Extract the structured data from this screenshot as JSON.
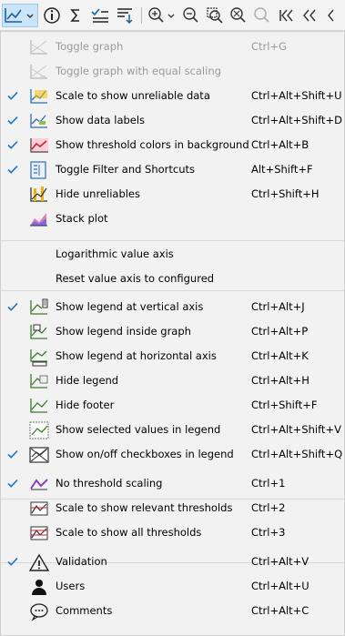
{
  "toolbar": {
    "buttons": [
      {
        "icon": "graph-dropdown-icon",
        "active": true
      },
      {
        "icon": "info-icon"
      },
      {
        "icon": "sigma-icon"
      },
      {
        "icon": "filter-check-icon"
      },
      {
        "icon": "sort-icon"
      },
      {
        "icon": "zoom-in-dropdown-icon"
      },
      {
        "icon": "zoom-out-icon"
      },
      {
        "icon": "zoom-area-icon"
      },
      {
        "icon": "zoom-reset-icon"
      },
      {
        "icon": "zoom-disabled-icon"
      },
      {
        "icon": "skip-first-icon"
      },
      {
        "icon": "step-back-icon"
      },
      {
        "icon": "back-partial-icon"
      }
    ]
  },
  "menu": {
    "items": [
      {
        "label": "Toggle graph",
        "shortcut": "Ctrl+G",
        "checked": false,
        "disabled": true,
        "icon": "graph-icon"
      },
      {
        "label": "Toggle graph with equal scaling",
        "shortcut": "",
        "checked": false,
        "disabled": true,
        "icon": "graph-equal-scale-icon"
      },
      {
        "label": "Scale to show unreliable data",
        "shortcut": "Ctrl+Alt+Shift+U",
        "checked": true,
        "disabled": false,
        "icon": "unreliable-scale-icon"
      },
      {
        "label": "Show data labels",
        "shortcut": "Ctrl+Alt+Shift+D",
        "checked": true,
        "disabled": false,
        "icon": "data-labels-icon"
      },
      {
        "label": "Show threshold colors  in background",
        "shortcut": "Ctrl+Alt+B",
        "checked": true,
        "disabled": false,
        "icon": "threshold-colors-icon"
      },
      {
        "label": "Toggle Filter and Shortcuts",
        "shortcut": "Alt+Shift+F",
        "checked": true,
        "disabled": false,
        "icon": "filter-panel-icon"
      },
      {
        "label": "Hide unreliables",
        "shortcut": "Ctrl+Shift+H",
        "checked": false,
        "disabled": false,
        "icon": "hide-unreliables-icon"
      },
      {
        "label": "Stack plot",
        "shortcut": "",
        "checked": false,
        "disabled": false,
        "icon": "stack-plot-icon"
      },
      {
        "label": "Logarithmic value axis",
        "shortcut": "",
        "checked": false,
        "disabled": false,
        "icon": ""
      },
      {
        "label": "Reset value axis to configured",
        "shortcut": "",
        "checked": false,
        "disabled": false,
        "icon": ""
      },
      {
        "label": "Show legend at vertical axis",
        "shortcut": "Ctrl+Alt+J",
        "checked": true,
        "disabled": false,
        "icon": "legend-vertical-icon"
      },
      {
        "label": "Show legend inside graph",
        "shortcut": "Ctrl+Alt+P",
        "checked": false,
        "disabled": false,
        "icon": "legend-inside-icon"
      },
      {
        "label": "Show legend at horizontal axis",
        "shortcut": "Ctrl+Alt+K",
        "checked": false,
        "disabled": false,
        "icon": "legend-horizontal-icon"
      },
      {
        "label": "Hide legend",
        "shortcut": "Ctrl+Alt+H",
        "checked": false,
        "disabled": false,
        "icon": "hide-legend-icon"
      },
      {
        "label": "Hide footer",
        "shortcut": "Ctrl+Shift+F",
        "checked": false,
        "disabled": false,
        "icon": "hide-footer-icon"
      },
      {
        "label": "Show selected values in legend",
        "shortcut": "Ctrl+Alt+Shift+V",
        "checked": false,
        "disabled": false,
        "icon": "selected-values-icon"
      },
      {
        "label": "Show on/off checkboxes in legend",
        "shortcut": "Ctrl+Alt+Shift+Q",
        "checked": true,
        "disabled": false,
        "icon": "legend-checkboxes-icon"
      },
      {
        "label": "No threshold scaling",
        "shortcut": "Ctrl+1",
        "checked": true,
        "disabled": false,
        "icon": "no-threshold-scaling-icon"
      },
      {
        "label": "Scale to show relevant thresholds",
        "shortcut": "Ctrl+2",
        "checked": false,
        "disabled": false,
        "icon": "relevant-thresholds-icon"
      },
      {
        "label": "Scale to show all thresholds",
        "shortcut": "Ctrl+3",
        "checked": false,
        "disabled": false,
        "icon": "all-thresholds-icon"
      },
      {
        "label": "Validation",
        "shortcut": "Ctrl+Alt+V",
        "checked": true,
        "disabled": false,
        "icon": "warning-triangle-icon"
      },
      {
        "label": "Users",
        "shortcut": "Ctrl+Alt+U",
        "checked": false,
        "disabled": false,
        "icon": "user-icon"
      },
      {
        "label": "Comments",
        "shortcut": "Ctrl+Alt+C",
        "checked": false,
        "disabled": false,
        "icon": "comment-icon"
      }
    ]
  },
  "colors": {
    "menu_bg": "#f2f2f2",
    "check": "#1e73c8",
    "disabled_text": "#9a9a9a",
    "active_button": "#cce4f7"
  }
}
